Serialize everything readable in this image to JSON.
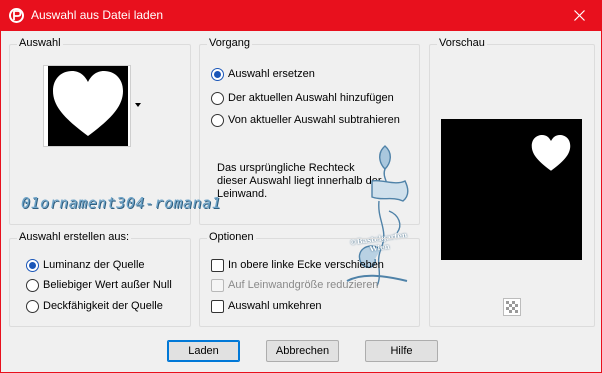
{
  "window": {
    "title": "Auswahl aus Datei laden",
    "close_icon": "close-icon",
    "app_icon": "paintshop-icon",
    "titlebar_color": "#e8101d"
  },
  "auswahl_group": {
    "label": "Auswahl",
    "thumbnail": "heart-selection-thumbnail"
  },
  "vorgang_group": {
    "label": "Vorgang",
    "options": [
      {
        "label": "Auswahl ersetzen",
        "selected": true
      },
      {
        "label": "Der aktuellen Auswahl hinzufügen",
        "selected": false
      },
      {
        "label": "Von aktueller Auswahl subtrahieren",
        "selected": false
      }
    ],
    "info_text": "Das ursprüngliche Rechteck dieser Auswahl liegt innerhalb der Leinwand."
  },
  "vorschau_group": {
    "label": "Vorschau",
    "transparency_toggle_icon": "checkerboard-icon"
  },
  "erstellen_group": {
    "label": "Auswahl erstellen aus:",
    "options": [
      {
        "label": "Luminanz der Quelle",
        "selected": true
      },
      {
        "label": "Beliebiger Wert außer Null",
        "selected": false
      },
      {
        "label": "Deckfähigkeit der Quelle",
        "selected": false
      }
    ]
  },
  "optionen_group": {
    "label": "Optionen",
    "checks": [
      {
        "label": "In obere linke Ecke verschieben",
        "checked": false,
        "enabled": true
      },
      {
        "label": "Auf Leinwandgröße reduzieren",
        "checked": false,
        "enabled": false
      },
      {
        "label": "Auswahl umkehren",
        "checked": false,
        "enabled": true
      }
    ]
  },
  "buttons": {
    "load": "Laden",
    "cancel": "Abbrechen",
    "help": "Hilfe"
  },
  "watermark": {
    "filename": "01ornament304-romana1",
    "stamp_line1": "©Bastelgarten",
    "stamp_line2": "Wien"
  }
}
